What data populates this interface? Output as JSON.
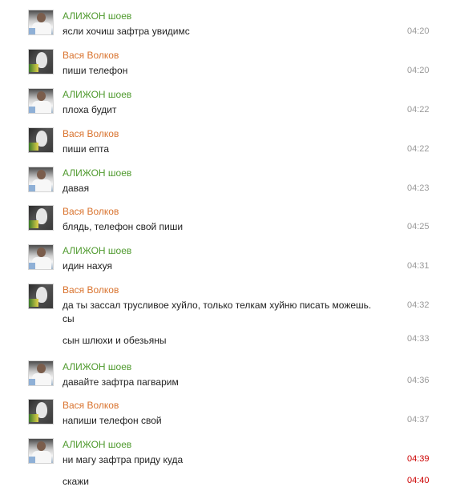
{
  "messages": [
    {
      "author": "АЛИЖОН шоев",
      "text": "ясли хочиш зафтра увидимс",
      "time": "04:20"
    },
    {
      "author": "Вася Волков",
      "text": "пиши телефон",
      "time": "04:20"
    },
    {
      "author": "АЛИЖОН шоев",
      "text": "плоха будит",
      "time": "04:22"
    },
    {
      "author": "Вася Волков",
      "text": "пиши епта",
      "time": "04:22"
    },
    {
      "author": "АЛИЖОН шоев",
      "text": "давая",
      "time": "04:23"
    },
    {
      "author": "Вася Волков",
      "text": "блядь, телефон свой пиши",
      "time": "04:25"
    },
    {
      "author": "АЛИЖОН шоев",
      "text": "идин нахуя",
      "time": "04:31"
    },
    {
      "author": "Вася Волков",
      "text": "да ты зассал трусливое хуйло, только телкам хуйню писать можешь.",
      "text2": "сы",
      "time": "04:32"
    },
    {
      "text": "сын шлюхи и обезьяны",
      "time": "04:33"
    },
    {
      "author": "АЛИЖОН шоев",
      "text": "давайте зафтра пагварим",
      "time": "04:36"
    },
    {
      "author": "Вася Волков",
      "text": "напиши телефон свой",
      "time": "04:37"
    },
    {
      "author": "АЛИЖОН шоев",
      "text": "ни магу зафтра приду куда",
      "time": "04:39"
    },
    {
      "text": "скажи",
      "time": "04:40"
    }
  ],
  "colors": {
    "alizhon_name": "#4f9a2e",
    "vasya_name": "#d9732e",
    "time_old": "#999999",
    "time_new": "#cc0000"
  }
}
